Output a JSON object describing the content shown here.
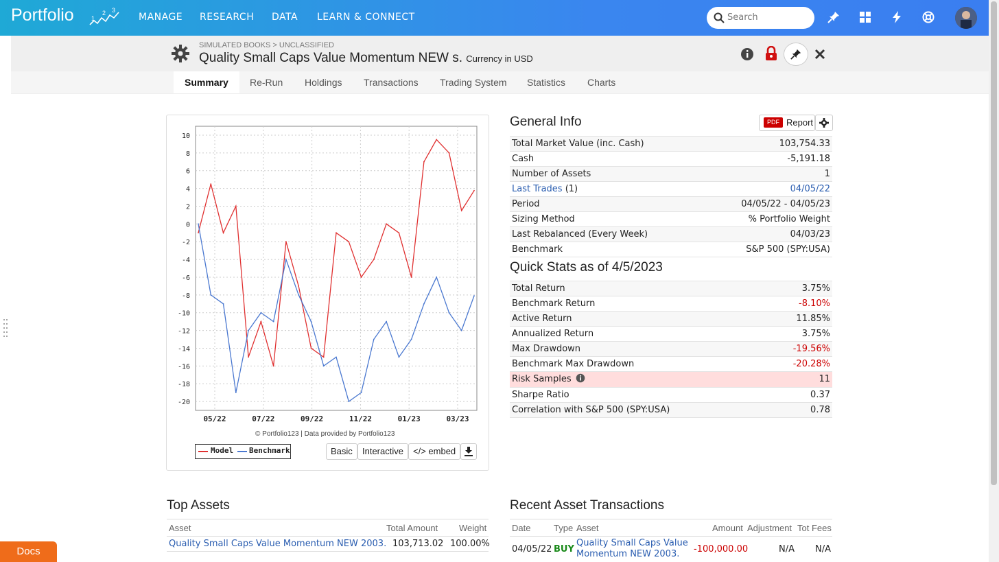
{
  "header": {
    "logo_text": "Portfolio",
    "nav": [
      "MANAGE",
      "RESEARCH",
      "DATA",
      "LEARN & CONNECT"
    ],
    "search_placeholder": "Search",
    "brand_color": "#3a86ef"
  },
  "page": {
    "breadcrumb": "SIMULATED BOOKS > UNCLASSIFIED",
    "title": "Quality Small Caps Value Momentum NEW s.",
    "currency": "Currency in USD"
  },
  "tabs": [
    "Summary",
    "Re-Run",
    "Holdings",
    "Transactions",
    "Trading System",
    "Statistics",
    "Charts"
  ],
  "active_tab": "Summary",
  "chart": {
    "credit": "© Portfolio123 | Data provided by Portfolio123",
    "legend": [
      "Model",
      "Benchmark"
    ],
    "buttons": [
      "Basic",
      "Interactive",
      "</> embed"
    ]
  },
  "chart_data": {
    "type": "line",
    "x": [
      "05/22",
      "07/22",
      "09/22",
      "11/22",
      "01/23",
      "03/23"
    ],
    "ylim": [
      -21,
      11
    ],
    "yticks": [
      10,
      8,
      6,
      4,
      2,
      0,
      -2,
      -4,
      -6,
      -8,
      -10,
      -12,
      -14,
      -16,
      -18,
      -20
    ],
    "xlabel": "",
    "ylabel": "",
    "grid": true,
    "legend_position": "bottom-left",
    "series": [
      {
        "name": "Model",
        "color": "#e03030",
        "values": [
          -1,
          4.5,
          -1,
          2,
          -15,
          -11,
          -16,
          -2,
          -7,
          -14,
          -15,
          -1,
          -2,
          -6,
          -4,
          0,
          -1,
          -6,
          7,
          9.5,
          8,
          1.5,
          3.75
        ]
      },
      {
        "name": "Benchmark",
        "color": "#4a78d0",
        "values": [
          0,
          -8,
          -9,
          -19,
          -12,
          -10,
          -11,
          -4,
          -8,
          -11,
          -16,
          -15,
          -20,
          -19,
          -13,
          -11,
          -15,
          -13,
          -9,
          -6,
          -10,
          -12,
          -8.1
        ]
      }
    ]
  },
  "general_info": {
    "title": "General Info",
    "report_label": "Report",
    "pdf_label": "PDF",
    "rows": [
      {
        "k": "Total Market Value (inc. Cash)",
        "v": "103,754.33"
      },
      {
        "k": "Cash",
        "v": "-5,191.18"
      },
      {
        "k": "Number of Assets",
        "v": "1"
      },
      {
        "k": "Last Trades",
        "k2": " (1)",
        "v": "04/05/22"
      },
      {
        "k": "Period",
        "v": "04/05/22 - 04/05/23"
      },
      {
        "k": "Sizing Method",
        "v": "% Portfolio Weight"
      },
      {
        "k": "Last Rebalanced (Every Week)",
        "v": "04/03/23"
      },
      {
        "k": "Benchmark",
        "v": "S&P 500 (SPY:USA)"
      }
    ]
  },
  "quick_stats": {
    "title": "Quick Stats as of 4/5/2023",
    "rows": [
      {
        "k": "Total Return",
        "v": "3.75%"
      },
      {
        "k": "Benchmark Return",
        "v": "-8.10%"
      },
      {
        "k": "Active Return",
        "v": "11.85%"
      },
      {
        "k": "Annualized Return",
        "v": "3.75%"
      },
      {
        "k": "Max Drawdown",
        "v": "-19.56%"
      },
      {
        "k": "Benchmark Max Drawdown",
        "v": "-20.28%"
      },
      {
        "k": "Risk Samples",
        "v": "11"
      },
      {
        "k": "Sharpe Ratio",
        "v": "0.37"
      },
      {
        "k": "Correlation with S&P 500 (SPY:USA)",
        "v": "0.78"
      }
    ]
  },
  "top_assets": {
    "title": "Top Assets",
    "headers": [
      "Asset",
      "Total Amount",
      "Weight"
    ],
    "rows": [
      {
        "asset": "Quality Small Caps Value Momentum NEW 2003.",
        "amount": "103,713.02",
        "weight": "100.00%"
      }
    ]
  },
  "recent_tx": {
    "title": "Recent Asset Transactions",
    "headers": [
      "Date",
      "Type",
      "Asset",
      "Amount",
      "Adjustment",
      "Tot Fees"
    ],
    "rows": [
      {
        "date": "04/05/22",
        "type": "BUY",
        "asset1": "Quality Small Caps Value",
        "asset2": "Momentum NEW 2003.",
        "amount": "-100,000.00",
        "adj": "N/A",
        "fees": "N/A"
      }
    ]
  },
  "docs_label": "Docs"
}
